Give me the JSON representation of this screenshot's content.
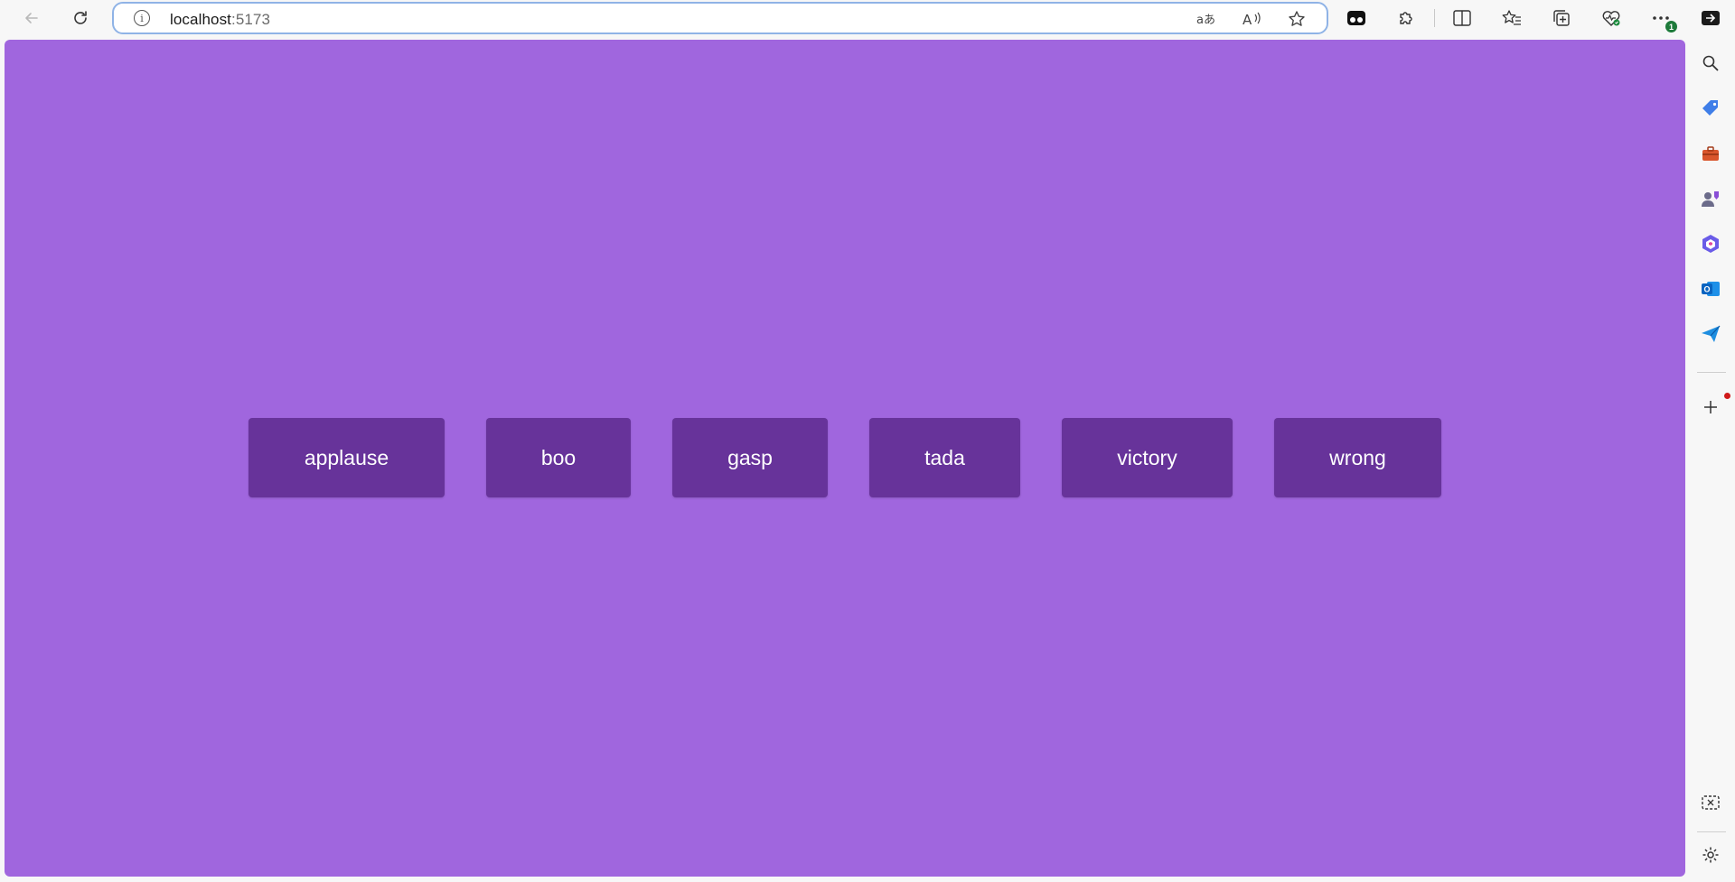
{
  "browser": {
    "url_host": "localhost",
    "url_port": ":5173",
    "toolbar_icons": [
      "extension-icon",
      "puzzle-icon",
      "split-screen-icon",
      "favorites-icon",
      "collections-icon",
      "browser-essentials-icon",
      "more-icon"
    ],
    "more_badge": "1"
  },
  "sidebar": {
    "icons": [
      "search-icon",
      "shopping-tag-icon",
      "tools-briefcase-icon",
      "games-icon",
      "copilot-icon",
      "outlook-icon",
      "send-icon",
      "add-icon",
      "screenshot-icon",
      "settings-icon"
    ]
  },
  "page": {
    "background": "#a066de",
    "button_color": "#67339a",
    "buttons": [
      {
        "label": "applause"
      },
      {
        "label": "boo"
      },
      {
        "label": "gasp"
      },
      {
        "label": "tada"
      },
      {
        "label": "victory"
      },
      {
        "label": "wrong"
      }
    ]
  }
}
